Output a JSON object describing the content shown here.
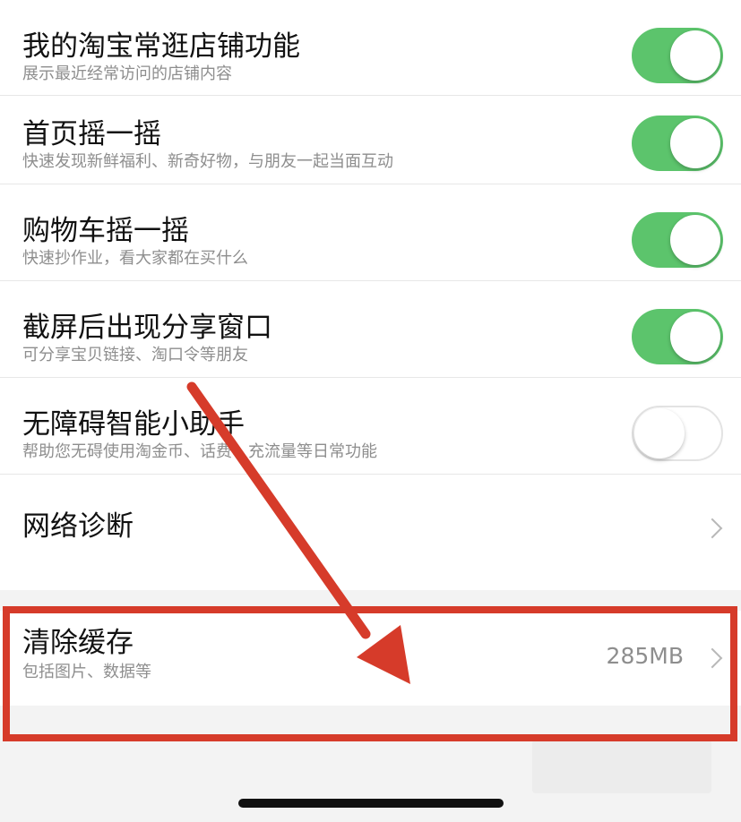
{
  "settings": [
    {
      "title": "我的淘宝常逛店铺功能",
      "subtitle": "展示最近经常访问的店铺内容",
      "enabled": true
    },
    {
      "title": "首页摇一摇",
      "subtitle": "快速发现新鲜福利、新奇好物，与朋友一起当面互动",
      "enabled": true
    },
    {
      "title": "购物车摇一摇",
      "subtitle": "快速抄作业，看大家都在买什么",
      "enabled": true
    },
    {
      "title": "截屏后出现分享窗口",
      "subtitle": "可分享宝贝链接、淘口令等朋友",
      "enabled": true
    },
    {
      "title": "无障碍智能小助手",
      "subtitle": "帮助您无碍使用淘金币、话费、充流量等日常功能",
      "enabled": false
    }
  ],
  "network": {
    "title": "网络诊断"
  },
  "cache": {
    "title": "清除缓存",
    "subtitle": "包括图片、数据等",
    "size": "285MB"
  },
  "colors": {
    "toggle_on": "#5cc46c",
    "annotation": "#d63b2a"
  }
}
